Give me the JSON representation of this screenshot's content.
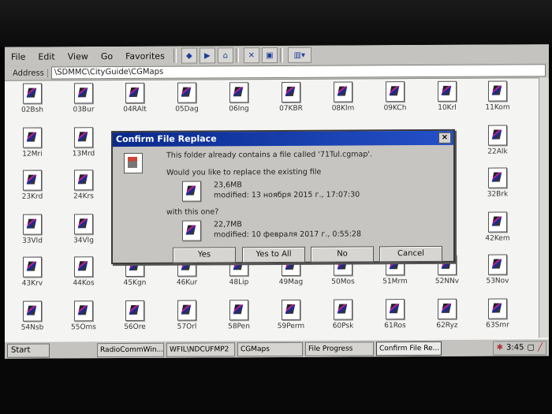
{
  "menu": {
    "items": [
      "File",
      "Edit",
      "View",
      "Go",
      "Favorites"
    ]
  },
  "toolbar": {
    "icons": [
      "back-icon",
      "forward-icon",
      "up-folder-icon",
      "cut-icon",
      "properties-icon",
      "views-icon"
    ]
  },
  "address": {
    "label": "Address",
    "value": "\\SDMMC\\CityGuide\\CGMaps"
  },
  "files": [
    "02Bsh",
    "03Bur",
    "04RAlt",
    "05Dag",
    "06Ing",
    "07KBR",
    "08Klm",
    "09KCh",
    "10Krl",
    "11Kom",
    "12Mri",
    "13Mrd",
    "22Alk",
    "23Krd",
    "24Krs",
    "32Brk",
    "33Vld",
    "34Vlg",
    "42Kem",
    "43Krv",
    "44Kos",
    "45Kgn",
    "46Kur",
    "48Lip",
    "49Mag",
    "50Mos",
    "51Mrm",
    "52NNv",
    "53Nov",
    "54Nsb",
    "55Oms",
    "56Ore",
    "57Orl",
    "58Pen",
    "59Perm",
    "60Psk",
    "61Ros",
    "62Ryz",
    "63Smr"
  ],
  "dialog": {
    "title": "Confirm File Replace",
    "close": "×",
    "line1": "This folder already contains a file called '71Tul.cgmap'.",
    "line2": "Would you like to replace the existing file",
    "existing_size": "23,6MB",
    "existing_modified": "modified: 13 ноября 2015 г., 17:07:30",
    "line3": "with this one?",
    "new_size": "22,7MB",
    "new_modified": "modified: 10 февраля 2017 г., 0:55:28",
    "buttons": {
      "yes": "Yes",
      "yes_all": "Yes to All",
      "no": "No",
      "cancel": "Cancel"
    }
  },
  "taskbar": {
    "start": "Start",
    "tasks": [
      "RadioCommWin...",
      "WFIL\\NDCUFMP2",
      "CGMaps",
      "File Progress",
      "Confirm File Re..."
    ],
    "time": "3:45"
  }
}
